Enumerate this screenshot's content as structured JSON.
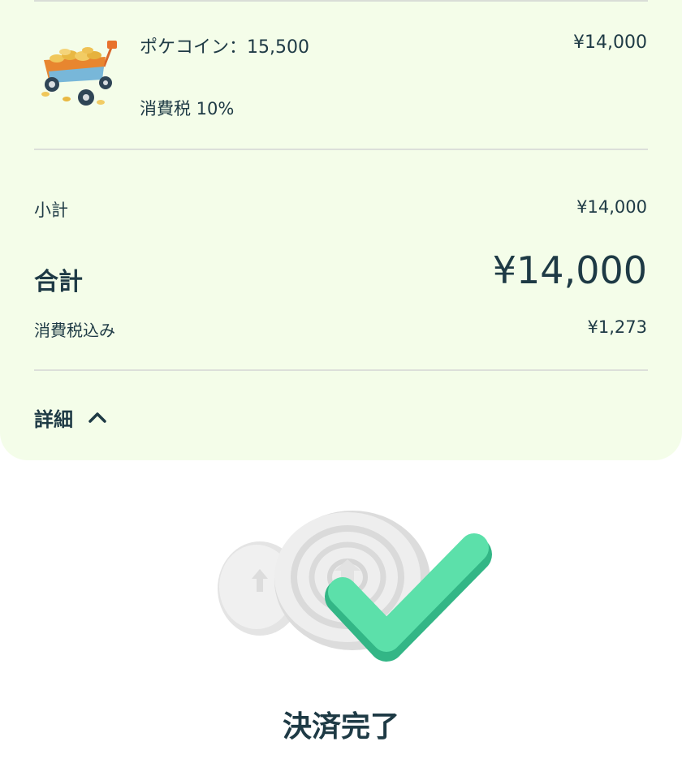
{
  "order": {
    "item": {
      "name": "ポケコイン：15,500",
      "price": "¥14,000",
      "tax_line": "消費税 10%",
      "image_icon": "coin-wagon-icon"
    },
    "subtotal": {
      "label": "小計",
      "value": "¥14,000"
    },
    "total": {
      "label": "合計",
      "value": "¥14,000"
    },
    "tax_included": {
      "label": "消費税込み",
      "value": "¥1,273"
    },
    "details_toggle": {
      "label": "詳細",
      "icon": "chevron-up-icon"
    }
  },
  "status": {
    "message": "決済完了",
    "icon": "payment-success-icon"
  },
  "colors": {
    "card_bg": "#f4fde9",
    "text": "#1e3a45",
    "check": "#4fd9a3",
    "divider": "#dcdfda"
  }
}
